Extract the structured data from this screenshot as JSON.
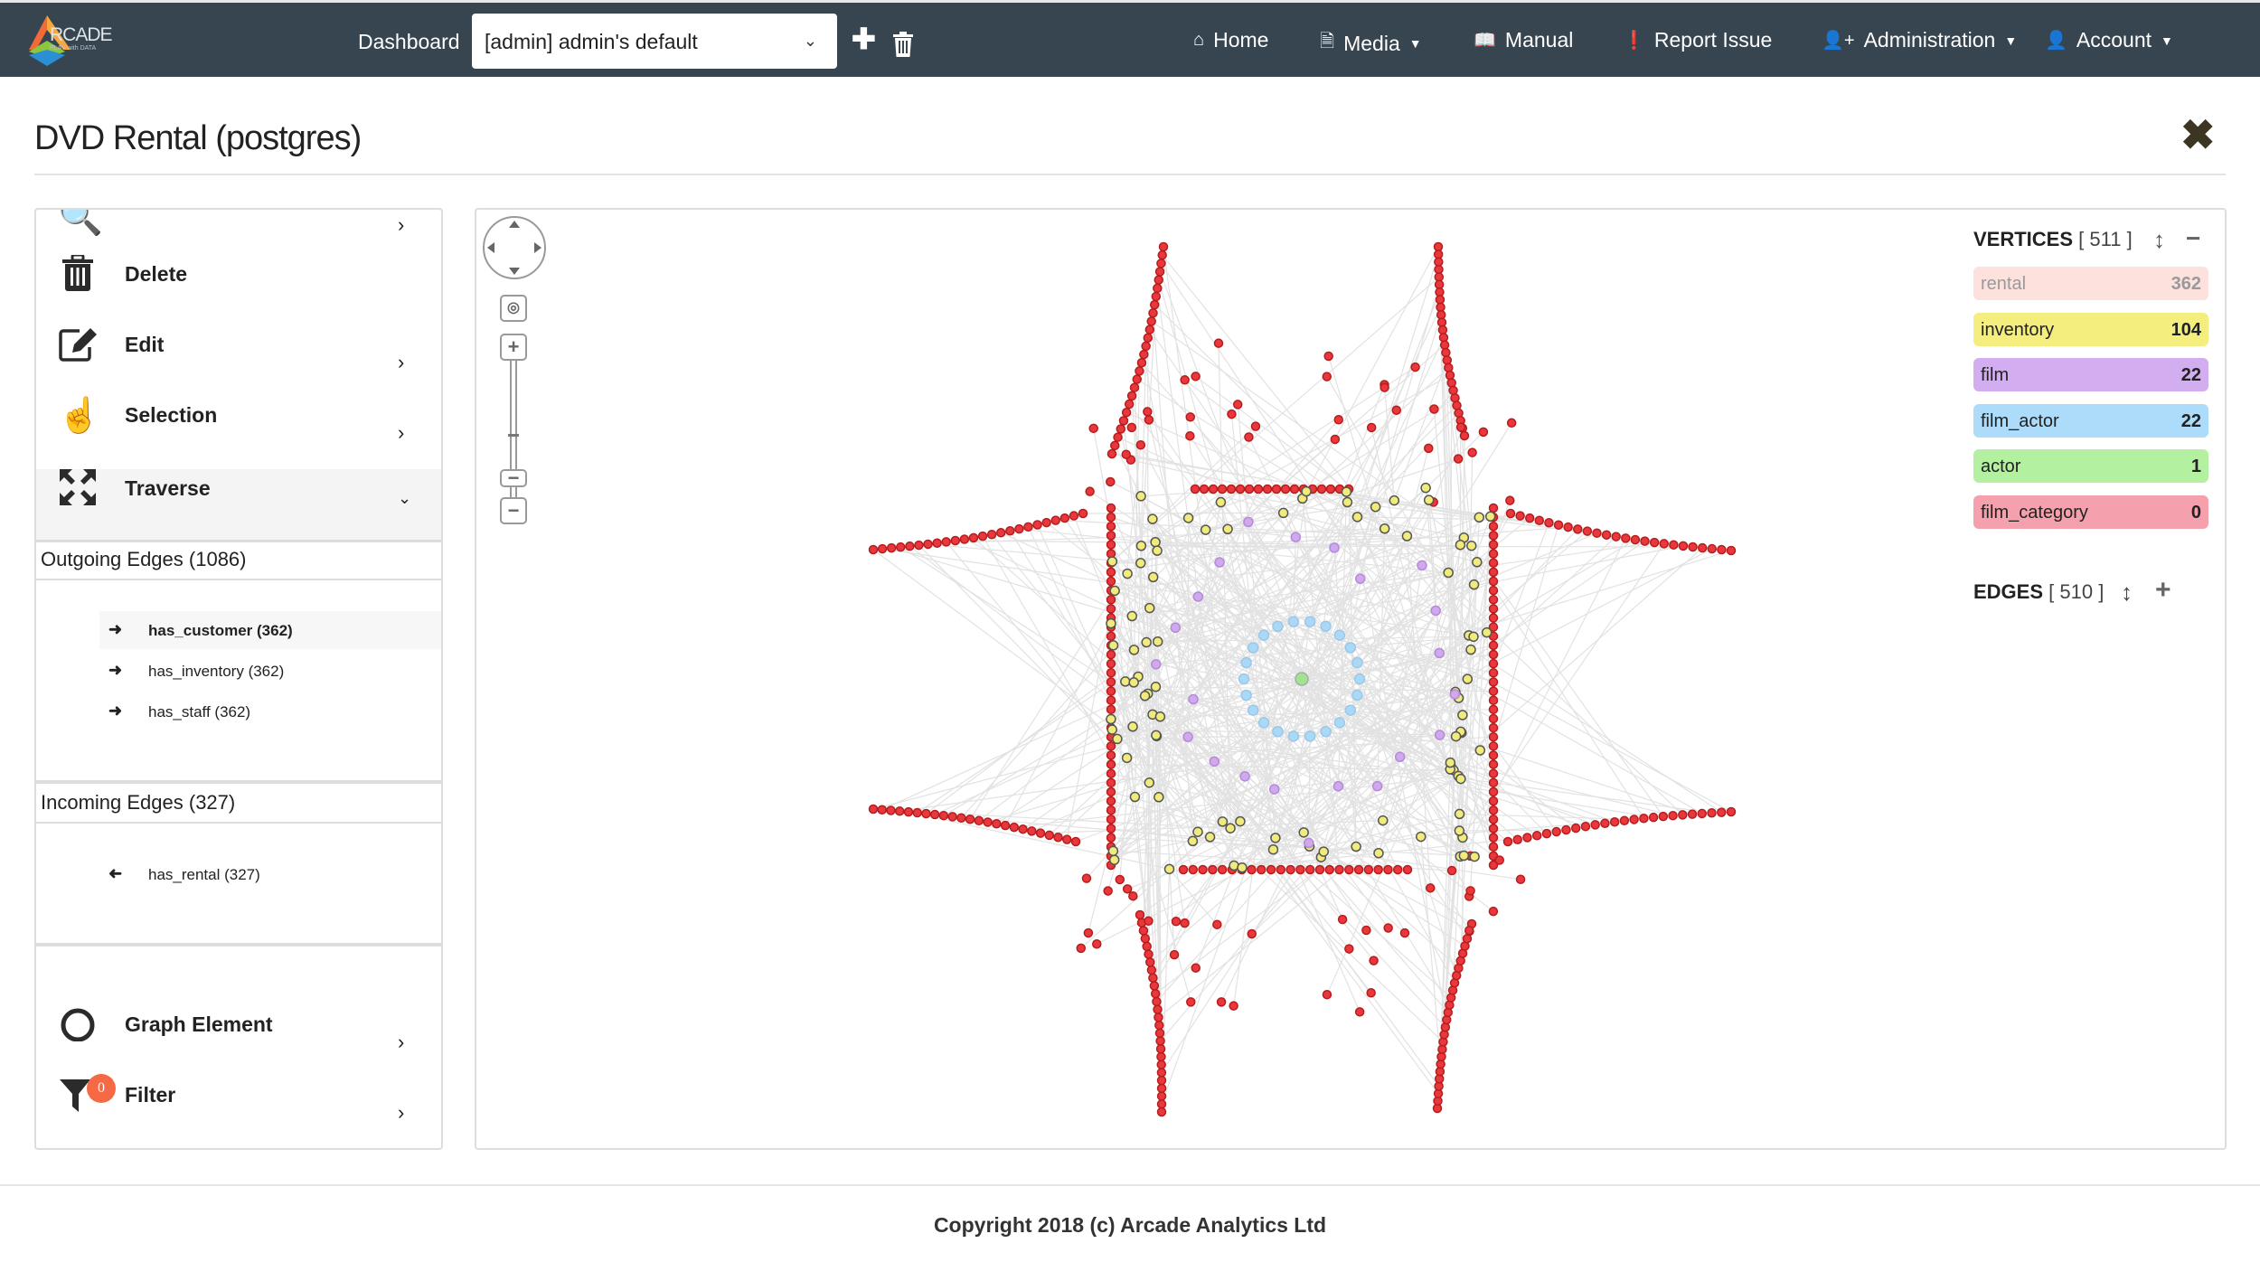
{
  "navbar": {
    "logo_text": "RCADE",
    "logo_sub": "PLAY with DATA",
    "dashboard_label": "Dashboard",
    "dashboard_select": "[admin] admin's default",
    "items": [
      {
        "label": "Home",
        "icon": "home-icon"
      },
      {
        "label": "Media",
        "icon": "media-icon",
        "dropdown": true
      },
      {
        "label": "Manual",
        "icon": "book-icon"
      },
      {
        "label": "Report Issue",
        "icon": "exclamation-icon"
      },
      {
        "label": "Administration",
        "icon": "user-plus-icon",
        "dropdown": true
      },
      {
        "label": "Account",
        "icon": "user-icon",
        "dropdown": true
      }
    ]
  },
  "page": {
    "title": "DVD Rental (postgres)"
  },
  "sidebar": {
    "items": [
      {
        "label": "Delete"
      },
      {
        "label": "Edit"
      },
      {
        "label": "Selection"
      },
      {
        "label": "Traverse"
      }
    ],
    "outgoing": {
      "header": "Outgoing Edges (1086)",
      "items": [
        "has_customer (362)",
        "has_inventory (362)",
        "has_staff (362)"
      ]
    },
    "incoming": {
      "header": "Incoming Edges (327)",
      "items": [
        "has_rental (327)"
      ]
    },
    "bottom_items": [
      {
        "label": "Graph Element"
      },
      {
        "label": "Filter",
        "badge": "0"
      }
    ]
  },
  "legend": {
    "vertices_title": "VERTICES",
    "vertices_count": "[ 511 ]",
    "vertices": [
      {
        "name": "rental",
        "count": "362",
        "bg": "#fde1dd",
        "fg": "#9a9a9a"
      },
      {
        "name": "inventory",
        "count": "104",
        "bg": "#f3ee7e",
        "fg": "#222222"
      },
      {
        "name": "film",
        "count": "22",
        "bg": "#d2aef0",
        "fg": "#222222"
      },
      {
        "name": "film_actor",
        "count": "22",
        "bg": "#acdcfa",
        "fg": "#222222"
      },
      {
        "name": "actor",
        "count": "1",
        "bg": "#b3f1a1",
        "fg": "#222222"
      },
      {
        "name": "film_category",
        "count": "0",
        "bg": "#f5a1ad",
        "fg": "#222222"
      }
    ],
    "edges_title": "EDGES",
    "edges_count": "[ 510 ]"
  },
  "colors": {
    "navbar": "#36454f",
    "rental_node": "#e8383d",
    "inventory_node": "#f0eb7a",
    "film_node": "#cfa8ee",
    "film_actor_node": "#aad8f7",
    "actor_node": "#9fe58e"
  },
  "footer": {
    "copyright": "Copyright 2018 (c) Arcade Analytics Ltd"
  }
}
